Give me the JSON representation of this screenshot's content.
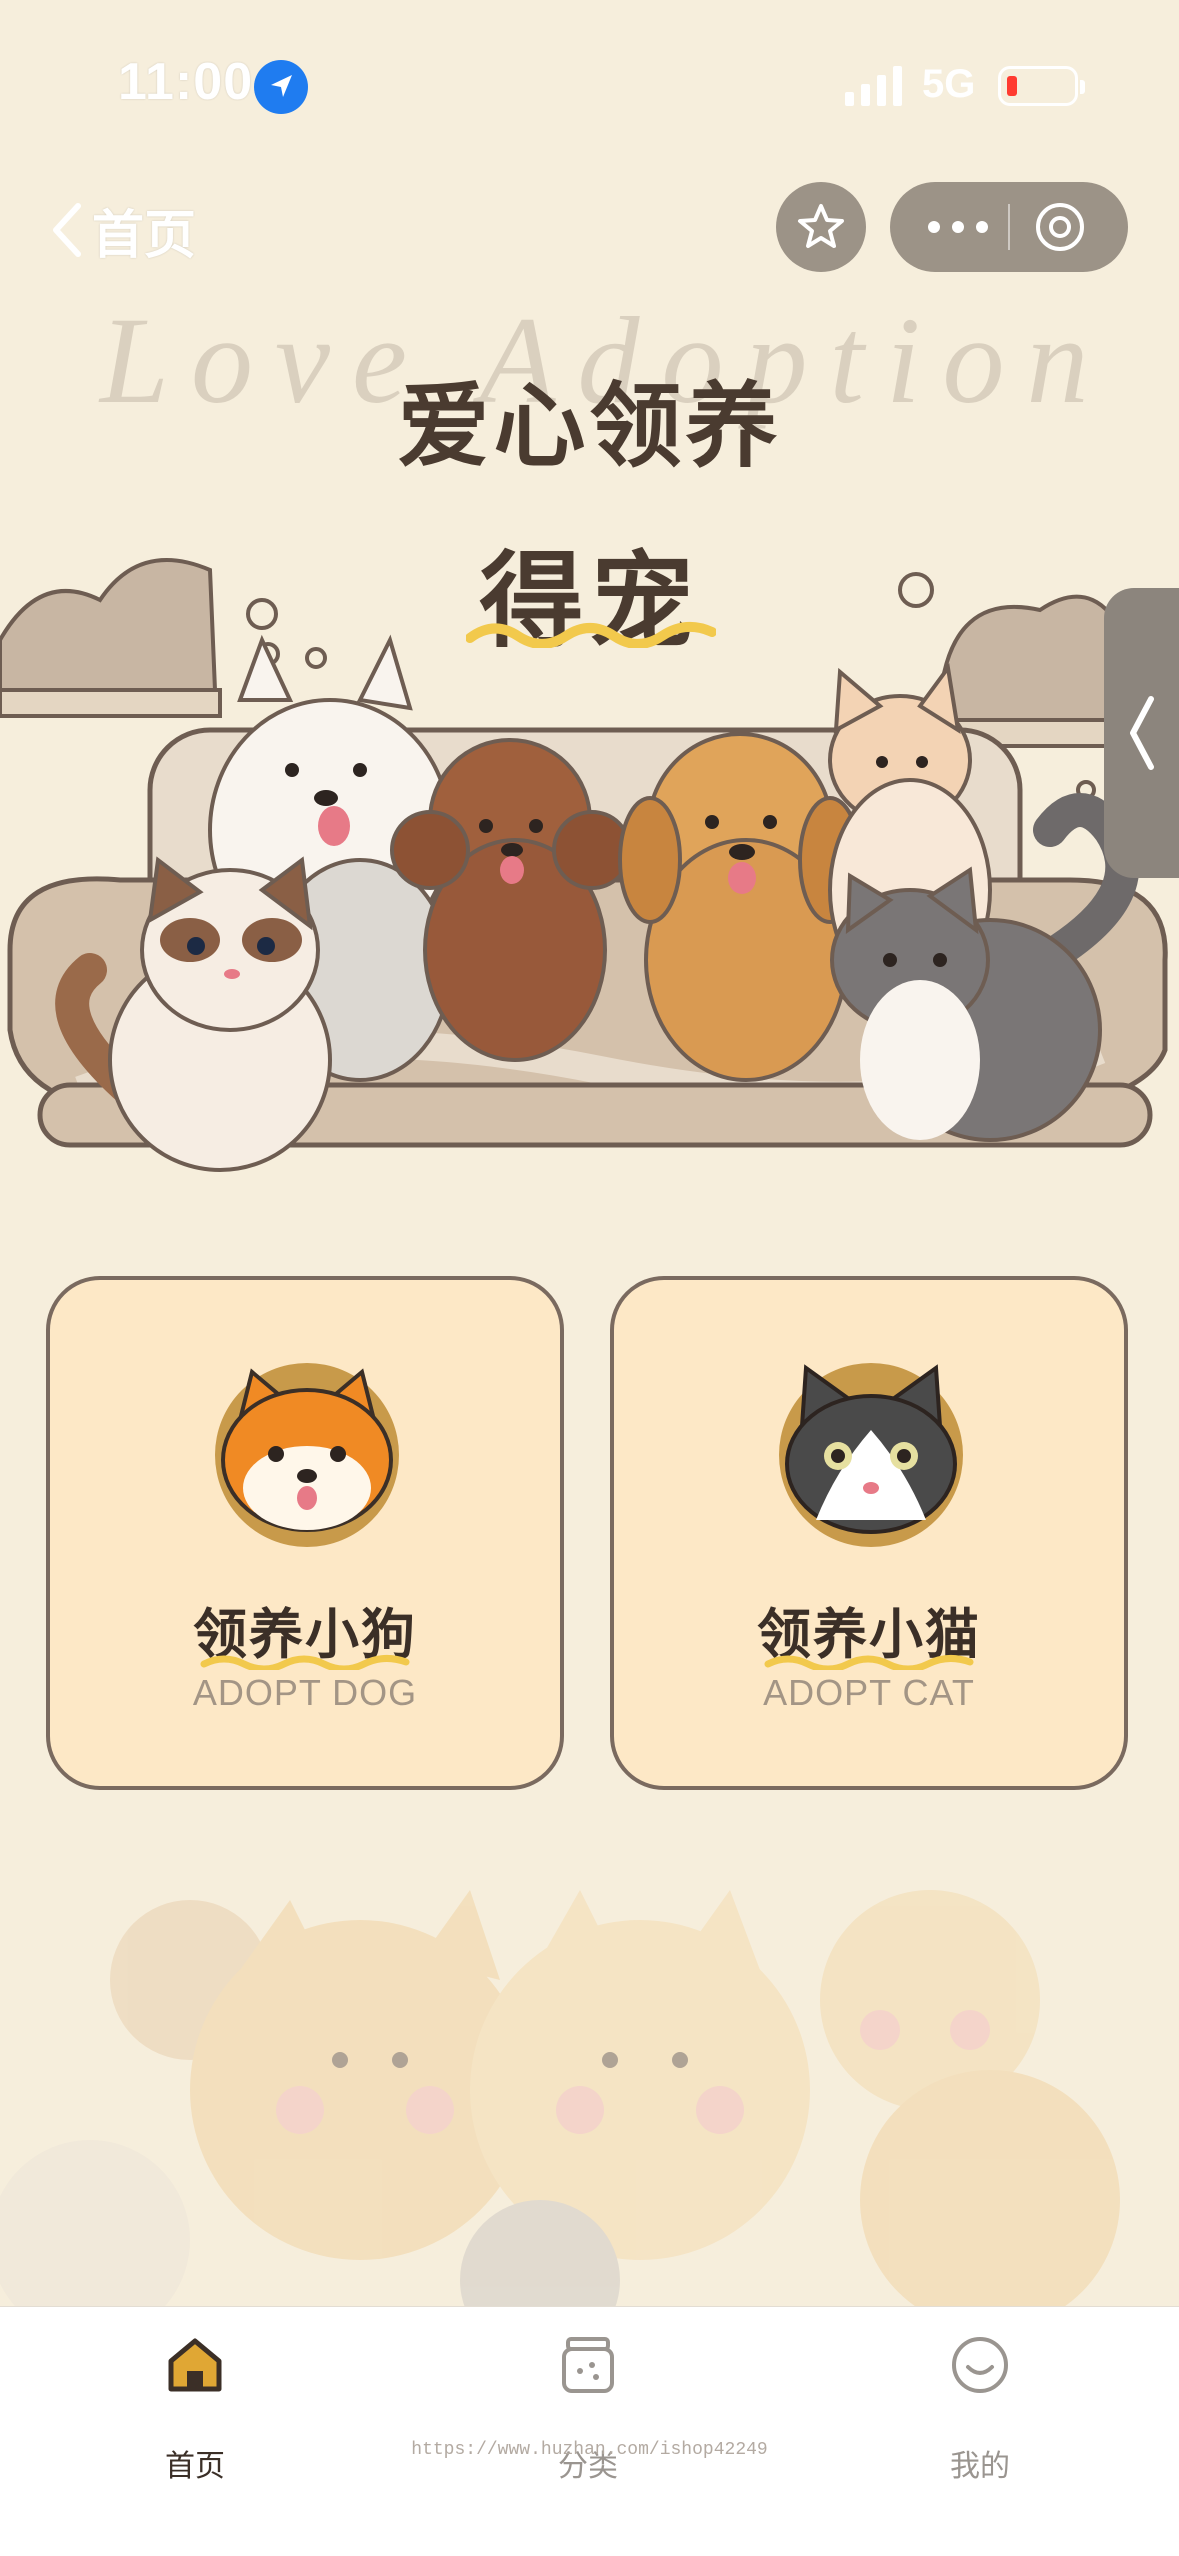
{
  "status_bar": {
    "time": "11:00",
    "network": "5G",
    "icons": [
      "location-arrow-icon",
      "signal-icon",
      "battery-low-icon"
    ],
    "battery_color": "#ff3b30"
  },
  "nav": {
    "back_label": "首页",
    "icons": [
      "chevron-left-icon",
      "star-icon",
      "more-icon",
      "close-circle-icon"
    ]
  },
  "hero": {
    "watermark": "Love Adoption",
    "title": "爱心领养",
    "subtitle": "得宠",
    "illustration": "dogs-and-cats-on-sofa"
  },
  "cards": [
    {
      "title": "领养小狗",
      "subtitle": "ADOPT DOG",
      "icon": "shiba-dog-icon"
    },
    {
      "title": "领养小猫",
      "subtitle": "ADOPT CAT",
      "icon": "tuxedo-cat-icon"
    }
  ],
  "tab_bar": {
    "items": [
      {
        "label": "首页",
        "icon": "home-icon",
        "active": true
      },
      {
        "label": "分类",
        "icon": "jar-icon",
        "active": false
      },
      {
        "label": "我的",
        "icon": "smile-icon",
        "active": false
      }
    ],
    "active_color": "#e0a734"
  },
  "footer_url": "https://www.huzhan.com/ishop42249",
  "colors": {
    "background": "#f6eedc",
    "card_fill": "#fde8c6",
    "card_border": "#7a6a5f",
    "title_text": "#4a3b30",
    "accent_yellow": "#f2c94c"
  }
}
